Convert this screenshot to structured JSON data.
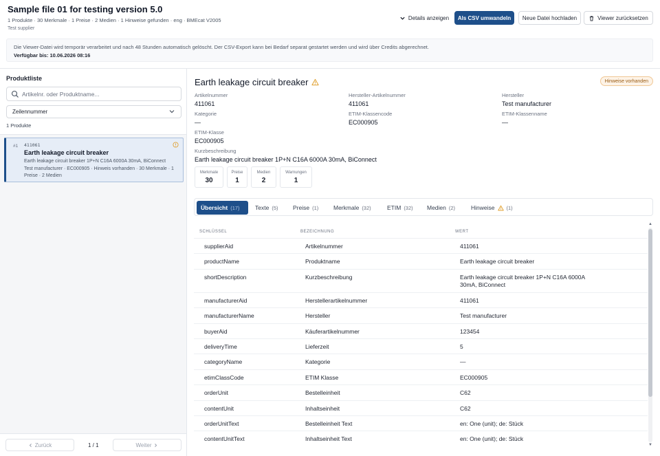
{
  "header": {
    "title": "Sample file 01 for testing version 5.0",
    "meta": "1 Produkte · 30 Merkmale · 1 Preise · 2 Medien · 1 Hinweise gefunden · eng · BMEcat V2005",
    "supplier": "Test supplier",
    "buttons": {
      "details": "Details anzeigen",
      "csv": "Als CSV umwandeln",
      "upload": "Neue Datei hochladen",
      "reset": "Viewer zurücksetzen"
    },
    "notice": "Die Viewer-Datei wird temporär verarbeitet und nach 48 Stunden automatisch gelöscht. Der CSV-Export kann bei Bedarf separat gestartet werden und wird über Credits abgerechnet.",
    "available": "Verfügbar bis: 10.06.2026 08:16"
  },
  "left": {
    "title": "Produktliste",
    "search_placeholder": "Artikelnr. oder Produktname...",
    "sort_value": "Zeilennummer",
    "count": "1 Produkte",
    "product": {
      "num": "#1",
      "aid": "411061",
      "name": "Earth leakage circuit breaker",
      "desc": "Earth leakage circuit breaker 1P+N C16A 6000A 30mA, BiConnect",
      "meta": "Test manufacturer · EC000905 · Hinweis vorhanden · 30 Merkmale · 1 Preise · 2 Medien"
    },
    "pager": {
      "prev": "Zurück",
      "info": "1 / 1",
      "next": "Weiter"
    }
  },
  "detail": {
    "title": "Earth leakage circuit breaker",
    "badge": "Hinweise vorhanden",
    "fields": {
      "artikelnummer": {
        "label": "Artikelnummer",
        "value": "411061"
      },
      "hersteller_aid": {
        "label": "Hersteller-Artikelnummer",
        "value": "411061"
      },
      "hersteller": {
        "label": "Hersteller",
        "value": "Test manufacturer"
      },
      "kategorie": {
        "label": "Kategorie",
        "value": "—"
      },
      "etim_code": {
        "label": "ETIM-Klassencode",
        "value": "EC000905"
      },
      "etim_name": {
        "label": "ETIM-Klassenname",
        "value": "—"
      },
      "etim_klasse": {
        "label": "ETIM-Klasse",
        "value": "EC000905"
      },
      "kurzbeschreibung": {
        "label": "Kurzbeschreibung",
        "value": "Earth leakage circuit breaker 1P+N C16A 6000A 30mA, BiConnect"
      }
    },
    "stats": [
      {
        "label": "Merkmale",
        "value": "30"
      },
      {
        "label": "Preise",
        "value": "1"
      },
      {
        "label": "Medien",
        "value": "2"
      },
      {
        "label": "Warnungen",
        "value": "1"
      }
    ],
    "tabs": [
      {
        "label": "Übersicht",
        "count": "(17)"
      },
      {
        "label": "Texte",
        "count": "(5)"
      },
      {
        "label": "Preise",
        "count": "(1)"
      },
      {
        "label": "Merkmale",
        "count": "(32)"
      },
      {
        "label": "ETIM",
        "count": "(32)"
      },
      {
        "label": "Medien",
        "count": "(2)"
      },
      {
        "label": "Hinweise",
        "count": "(1)"
      }
    ],
    "table": {
      "headers": [
        "SCHLÜSSEL",
        "BEZEICHNUNG",
        "WERT"
      ],
      "rows": [
        [
          "supplierAid",
          "Artikelnummer",
          "411061"
        ],
        [
          "productName",
          "Produktname",
          "Earth leakage circuit breaker"
        ],
        [
          "shortDescription",
          "Kurzbeschreibung",
          "Earth leakage circuit breaker 1P+N C16A 6000A 30mA, BiConnect"
        ],
        [
          "manufacturerAid",
          "Herstellerartikelnummer",
          "411061"
        ],
        [
          "manufacturerName",
          "Hersteller",
          "Test manufacturer"
        ],
        [
          "buyerAid",
          "Käuferartikelnummer",
          "123454"
        ],
        [
          "deliveryTime",
          "Lieferzeit",
          "5"
        ],
        [
          "categoryName",
          "Kategorie",
          "—"
        ],
        [
          "etimClassCode",
          "ETIM Klasse",
          "EC000905"
        ],
        [
          "orderUnit",
          "Bestelleinheit",
          "C62"
        ],
        [
          "contentUnit",
          "Inhaltseinheit",
          "C62"
        ],
        [
          "orderUnitText",
          "Bestelleinheit Text",
          "en: One (unit); de: Stück"
        ],
        [
          "contentUnitText",
          "Inhaltseinheit Text",
          "en: One (unit); de: Stück"
        ]
      ]
    }
  },
  "colors": {
    "primary": "#1e4f8a",
    "warning": "#e0a030"
  }
}
